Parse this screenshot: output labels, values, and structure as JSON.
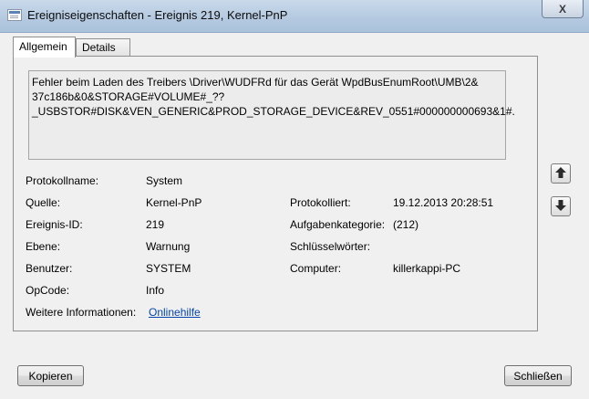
{
  "window": {
    "title": "Ereigniseigenschaften - Ereignis 219, Kernel-PnP",
    "close_label": "X"
  },
  "tabs": [
    {
      "label": "Allgemein",
      "active": true
    },
    {
      "label": "Details",
      "active": false
    }
  ],
  "message": {
    "lines": [
      "Fehler beim Laden des Treibers \\Driver\\WUDFRd für das Gerät WpdBusEnumRoot\\UMB\\2&",
      "37c186b&0&STORAGE#VOLUME#_??",
      "_USBSTOR#DISK&VEN_GENERIC&PROD_STORAGE_DEVICE&REV_0551#000000000693&1#."
    ]
  },
  "fields": {
    "protokollname": {
      "label": "Protokollname:",
      "value": "System"
    },
    "quelle": {
      "label": "Quelle:",
      "value": "Kernel-PnP"
    },
    "protokolliert": {
      "label": "Protokolliert:",
      "value": "19.12.2013 20:28:51"
    },
    "ereignis_id": {
      "label": "Ereignis-ID:",
      "value": "219"
    },
    "aufgabenkategorie": {
      "label": "Aufgabenkategorie:",
      "value": "(212)"
    },
    "ebene": {
      "label": "Ebene:",
      "value": "Warnung"
    },
    "schluesselwoerter": {
      "label": "Schlüsselwörter:",
      "value": ""
    },
    "benutzer": {
      "label": "Benutzer:",
      "value": "SYSTEM"
    },
    "computer": {
      "label": "Computer:",
      "value": "killerkappi-PC"
    },
    "opcode": {
      "label": "OpCode:",
      "value": "Info"
    },
    "weitere": {
      "label": "Weitere Informationen:",
      "link": "Onlinehilfe"
    }
  },
  "side_buttons": {
    "up_icon": "arrow-up-icon",
    "down_icon": "arrow-down-icon"
  },
  "buttons": {
    "copy": "Kopieren",
    "close": "Schließen"
  },
  "colors": {
    "titlebar": "#b4c9e0",
    "link": "#0645ad",
    "window_bg": "#f0f0f0"
  }
}
